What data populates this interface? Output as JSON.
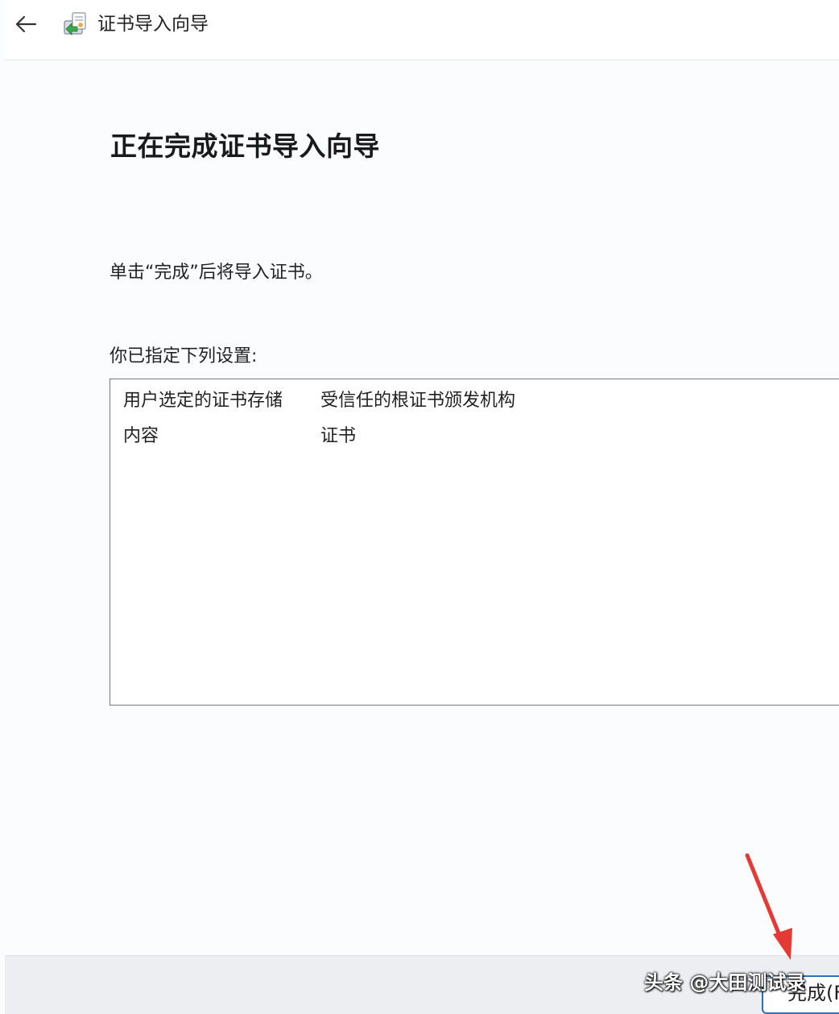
{
  "header": {
    "window_title": "证书导入向导",
    "back_icon": "arrow-left-icon",
    "wizard_icon": "certificate-wizard-icon"
  },
  "main": {
    "page_title": "正在完成证书导入向导",
    "instruction": "单击“完成”后将导入证书。",
    "settings_label": "你已指定下列设置:",
    "settings": [
      {
        "key": "用户选定的证书存储",
        "value": "受信任的根证书颁发机构"
      },
      {
        "key": "内容",
        "value": "证书"
      }
    ]
  },
  "footer": {
    "finish_label": "完成(F)"
  },
  "overlay": {
    "watermark": "头条 @大田测试录",
    "arrow_color": "#e53935"
  }
}
